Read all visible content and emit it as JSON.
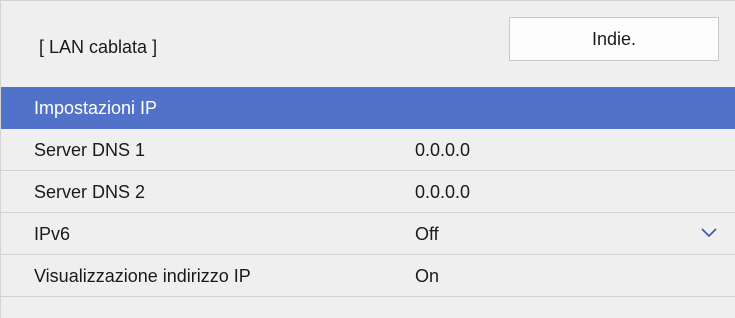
{
  "header": {
    "title": "[ LAN cablata ]",
    "back_label": "Indie."
  },
  "menu": {
    "items": [
      {
        "label": "Impostazioni IP",
        "value": "",
        "selected": true
      },
      {
        "label": "Server DNS 1",
        "value": "0.0.0.0"
      },
      {
        "label": "Server DNS 2",
        "value": "0.0.0.0"
      },
      {
        "label": "IPv6",
        "value": "Off",
        "icon": "chevron-down-icon"
      },
      {
        "label": "Visualizzazione indirizzo IP",
        "value": "On"
      }
    ]
  },
  "colors": {
    "selection": "#5272c9",
    "panel_background": "#efefef"
  }
}
